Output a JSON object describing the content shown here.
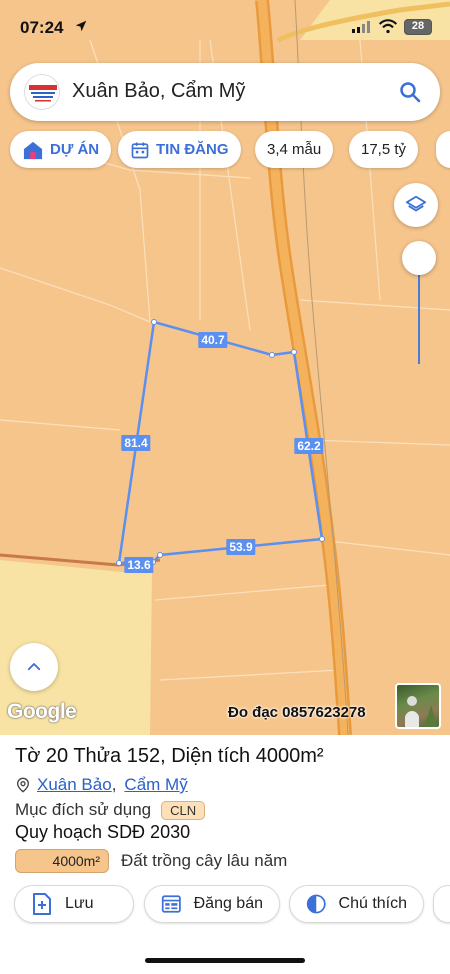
{
  "status_bar": {
    "time": "07:24",
    "battery": "28"
  },
  "search": {
    "value": "Xuân Bảo, Cẩm Mỹ"
  },
  "chips": [
    {
      "label": "DỰ ÁN",
      "icon": "home-icon"
    },
    {
      "label": "TIN ĐĂNG",
      "icon": "calendar-icon"
    },
    {
      "label": "3,4 mẫu"
    },
    {
      "label": "17,5 tỷ"
    }
  ],
  "map": {
    "edge_labels": [
      "40.7",
      "62.2",
      "53.9",
      "13.6",
      "81.4"
    ],
    "google_logo": "Google",
    "contact": "Đo đạc 0857623278",
    "colors": {
      "land": "#f6c58c",
      "road": "#f2a040",
      "plot_outline": "#5b8ff0",
      "other_land": "#f8e3a4"
    }
  },
  "parcel": {
    "title": "Tờ 20 Thửa 152, Diện tích 4000m²",
    "address_part1": "Xuân Bảo",
    "address_sep": ",",
    "address_part2": "Cẩm Mỹ",
    "purpose_label": "Mục đích sử dụng",
    "purpose_code": "CLN",
    "plan_label": "Quy hoạch SDĐ 2030",
    "area_value": "4000m²",
    "area_description": "Đất trồng cây lâu năm"
  },
  "actions": [
    {
      "label": "Lưu",
      "icon": "add-document-icon"
    },
    {
      "label": "Đăng bán",
      "icon": "listing-icon"
    },
    {
      "label": "Chú thích",
      "icon": "legend-icon"
    }
  ]
}
